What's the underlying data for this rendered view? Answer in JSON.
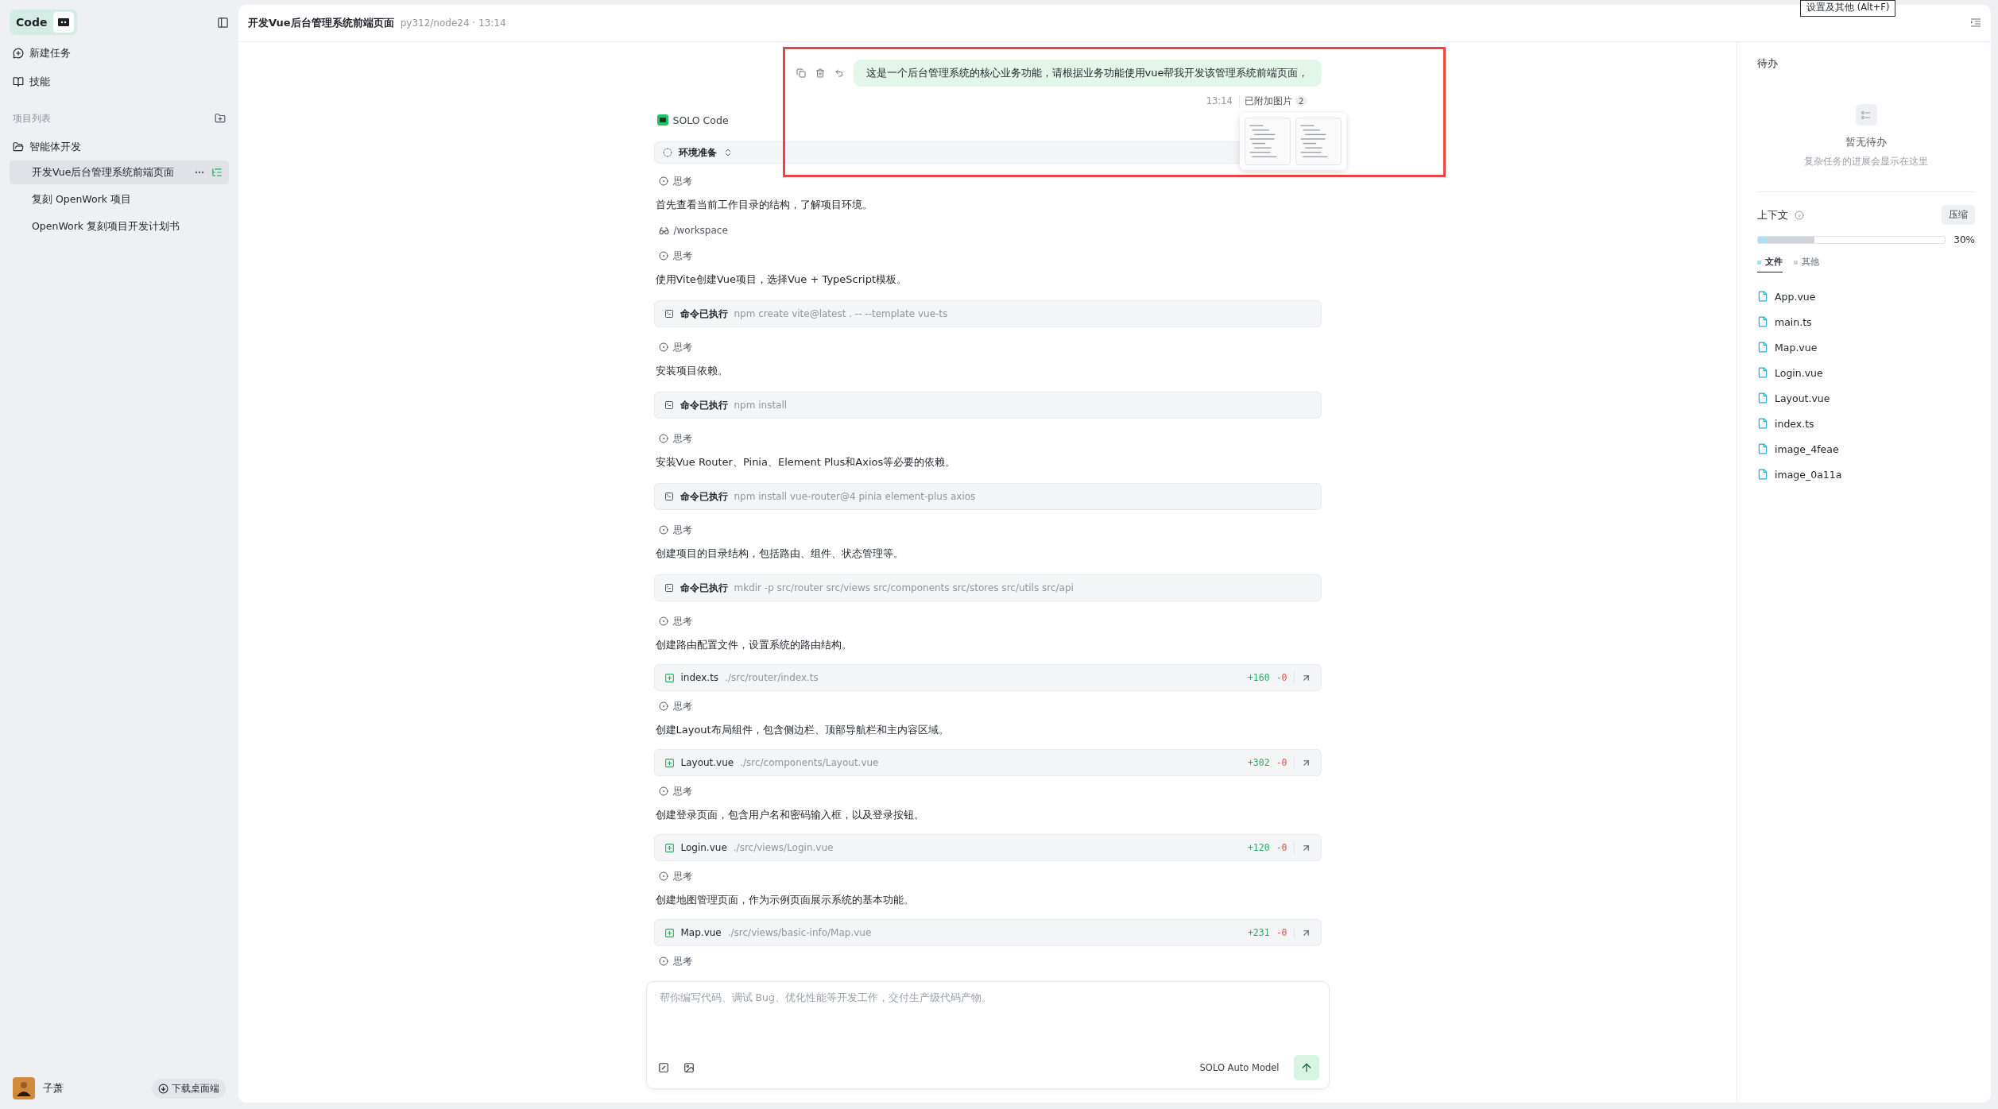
{
  "tooltip": {
    "text": "设置及其他 (Alt+F)"
  },
  "sidebar": {
    "brand": {
      "label": "Code",
      "selected": true
    },
    "nav": [
      {
        "label": "新建任务",
        "kind": "new"
      },
      {
        "label": "技能",
        "kind": "skills"
      }
    ],
    "section_title": "项目列表",
    "tree": [
      {
        "label": "智能体开发",
        "expanded": true,
        "children": [
          {
            "label": "开发Vue后台管理系统前端页面",
            "selected": true
          },
          {
            "label": "复刻 OpenWork 项目",
            "selected": false
          },
          {
            "label": "OpenWork 复刻项目开发计划书",
            "selected": false
          }
        ]
      }
    ],
    "user": {
      "name": "子萧"
    },
    "download": "下载桌面端"
  },
  "header": {
    "title": "开发Vue后台管理系统前端页面",
    "meta": "py312/node24 · 13:14"
  },
  "chat": {
    "user_message": {
      "text": "这是一个后台管理系统的核心业务功能，请根据业务功能使用vue帮我开发该管理系统前端页面，",
      "time": "13:14",
      "attachments_label": "已附加图片",
      "attachments_count": "2",
      "attachments": [
        {
          "kind": "image"
        },
        {
          "kind": "image"
        }
      ]
    },
    "agent": "SOLO Code",
    "stage": {
      "label": "环境准备"
    },
    "steps": [
      {
        "kind": "thought",
        "label": "思考"
      },
      {
        "kind": "text",
        "text": "首先查看当前工作目录的结构，了解项目环境。"
      },
      {
        "kind": "path",
        "path": "/workspace"
      },
      {
        "kind": "thought",
        "label": "思考"
      },
      {
        "kind": "text",
        "text": "使用Vite创建Vue项目，选择Vue + TypeScript模板。"
      },
      {
        "kind": "command",
        "label": "命令已执行",
        "command": "npm create vite@latest . -- --template vue-ts"
      },
      {
        "kind": "thought",
        "label": "思考"
      },
      {
        "kind": "text",
        "text": "安装项目依赖。"
      },
      {
        "kind": "command",
        "label": "命令已执行",
        "command": "npm install"
      },
      {
        "kind": "thought",
        "label": "思考"
      },
      {
        "kind": "text",
        "text": "安装Vue Router、Pinia、Element Plus和Axios等必要的依赖。"
      },
      {
        "kind": "command",
        "label": "命令已执行",
        "command": "npm install vue-router@4 pinia element-plus axios"
      },
      {
        "kind": "thought",
        "label": "思考"
      },
      {
        "kind": "text",
        "text": "创建项目的目录结构，包括路由、组件、状态管理等。"
      },
      {
        "kind": "command",
        "label": "命令已执行",
        "command": "mkdir -p src/router src/views src/components src/stores src/utils src/api"
      },
      {
        "kind": "thought",
        "label": "思考"
      },
      {
        "kind": "text",
        "text": "创建路由配置文件，设置系统的路由结构。"
      },
      {
        "kind": "file",
        "name": "index.ts",
        "path": "./src/router/index.ts",
        "added": "+160",
        "removed": "-0"
      },
      {
        "kind": "thought",
        "label": "思考"
      },
      {
        "kind": "text",
        "text": "创建Layout布局组件，包含侧边栏、顶部导航栏和主内容区域。"
      },
      {
        "kind": "file",
        "name": "Layout.vue",
        "path": "./src/components/Layout.vue",
        "added": "+302",
        "removed": "-0"
      },
      {
        "kind": "thought",
        "label": "思考"
      },
      {
        "kind": "text",
        "text": "创建登录页面，包含用户名和密码输入框，以及登录按钮。"
      },
      {
        "kind": "file",
        "name": "Login.vue",
        "path": "./src/views/Login.vue",
        "added": "+120",
        "removed": "-0"
      },
      {
        "kind": "thought",
        "label": "思考"
      },
      {
        "kind": "text",
        "text": "创建地图管理页面，作为示例页面展示系统的基本功能。"
      },
      {
        "kind": "file",
        "name": "Map.vue",
        "path": "./src/views/basic-info/Map.vue",
        "added": "+231",
        "removed": "-0"
      },
      {
        "kind": "thought",
        "label": "思考"
      }
    ]
  },
  "composer": {
    "placeholder": "帮你编写代码、调试 Bug、优化性能等开发工作，交付生产级代码产物。",
    "model": "SOLO Auto Model"
  },
  "todo": {
    "title": "待办",
    "empty_title": "暂无待办",
    "empty_hint": "复杂任务的进展会显示在这里"
  },
  "context": {
    "title": "上下文",
    "compress": "压缩",
    "percent": "30%",
    "segments": [
      {
        "level": 0.05,
        "color": "#a9e1f6"
      },
      {
        "level": 0.3,
        "color": "#cfd3db"
      }
    ],
    "tabs": [
      {
        "label": "文件",
        "selected": true,
        "color": "#a9e1f6"
      },
      {
        "label": "其他",
        "selected": false,
        "color": "#cfd3db"
      }
    ],
    "files": [
      "App.vue",
      "main.ts",
      "Map.vue",
      "Login.vue",
      "Layout.vue",
      "index.ts",
      "image_4feae",
      "image_0a11a"
    ]
  }
}
